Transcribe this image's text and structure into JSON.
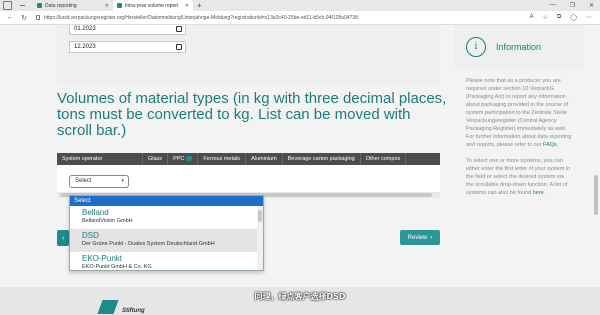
{
  "browser": {
    "tabs": [
      {
        "label": "Data reporting"
      },
      {
        "label": "Intra-year volume report"
      }
    ],
    "new_tab": "+",
    "url": "https://lucid.verpackungsregister.org/Hersteller/Datenmeldung/Unterjahrige-Meldung?registrationId=c13e2c40-25be-ed11-b5cb-94f128a04738",
    "window_controls": [
      "—",
      "❐",
      "✕"
    ]
  },
  "dates": {
    "from": "01.2023",
    "to": "12.2023"
  },
  "heading": "Volumes of material types (in kg with three decimal places, tons must be converted to kg. List can be moved with scroll bar.)",
  "table": {
    "columns": [
      "System operator",
      "Glass",
      "PPC",
      "Ferrous metals",
      "Aluminium",
      "Beverage carton packaging",
      "Other compos"
    ]
  },
  "select": {
    "value": "Select"
  },
  "dropdown": {
    "selected": "Select",
    "options": [
      {
        "name": "Belland",
        "sub": "BellandVision GmbH"
      },
      {
        "name": "DSD",
        "sub": "Der Grüne Punkt - Duales System Deutschland GmbH"
      },
      {
        "name": "EKO-Punkt",
        "sub": "EKO-Punkt GmbH & Co. KG"
      }
    ]
  },
  "buttons": {
    "back": "‹",
    "review": "Review",
    "review_arrow": "›"
  },
  "sidebar": {
    "icon": "i",
    "title": "Information",
    "para1": "Please note that as a producer you are required under section 10 VerpackG (Packaging Act) to report any information about packaging provided in the course of system participation to the Zentrale Stelle Verpackungsregister (Central Agency Packaging Register) immediately as well. For further information about data reporting and reports, please refer to our",
    "para1_link": "FAQs",
    "para2": "To select one or more systems, you can either enter the first letter of your system in the field or select the desired system via the scrollable drop-down function. A list of systems can also be found",
    "para2_link": "here"
  },
  "subtitle": "同理，绿点客户选择DSD",
  "footer": {
    "logo_text": "Stiftung"
  },
  "colors": {
    "accent": "#1b7d7b",
    "button": "#2b9696",
    "header_row": "#4d4d4d",
    "dropdown_selected": "#1e6ec9"
  }
}
